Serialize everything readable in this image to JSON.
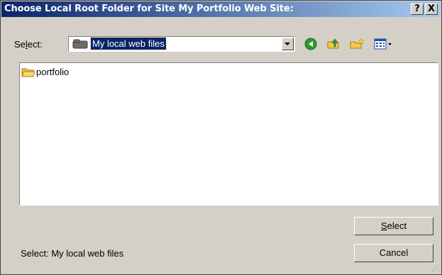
{
  "dialog": {
    "title": "Choose Local Root Folder for Site My Portfolio Web Site:",
    "help_button": "?",
    "close_button": "X"
  },
  "select_row": {
    "label_pre": "Se",
    "label_underlined": "l",
    "label_post": "ect:",
    "current_folder": "My local web files"
  },
  "toolbar": {
    "icons": [
      "back-icon",
      "up-folder-icon",
      "new-folder-icon",
      "view-menu-icon"
    ]
  },
  "file_list": {
    "items": [
      {
        "name": "portfolio",
        "icon": "folder-icon"
      }
    ]
  },
  "buttons": {
    "select_underlined": "S",
    "select_rest": "elect",
    "cancel": "Cancel"
  },
  "status": {
    "text": "Select: My local web files"
  },
  "colors": {
    "title_start": "#0a246a",
    "title_end": "#a6caf0",
    "face": "#d4d0c8",
    "selection": "#0a246a"
  }
}
